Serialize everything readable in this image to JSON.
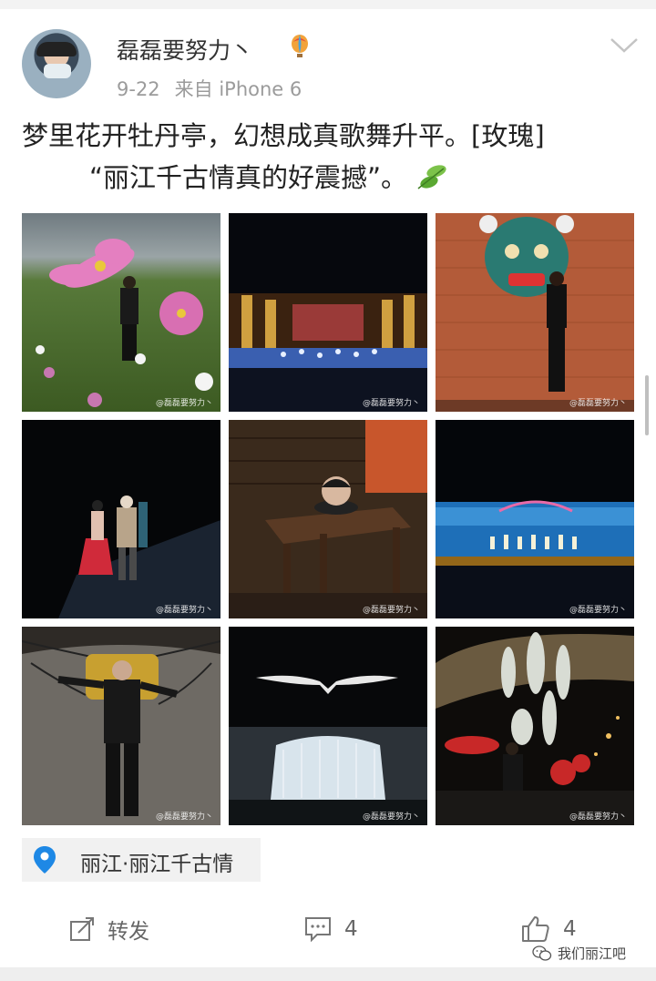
{
  "user": {
    "name": "磊磊要努力丶",
    "date": "9-22",
    "source": "来自 iPhone 6"
  },
  "post": {
    "line1": "梦里花开牡丹亭，幻想成真歌舞升平。[玫瑰]",
    "line2": "“丽江千古情真的好震撼”。"
  },
  "photos": {
    "watermark": "@磊磊要努力丶",
    "items": [
      "cosmos-flower-field",
      "stage-show-wide",
      "mask-wall-portrait",
      "red-dress-duet",
      "desk-with-head",
      "blue-stage-show",
      "chained-wall-pose",
      "waterfall-stage",
      "night-festival"
    ]
  },
  "location": {
    "label": "丽江·丽江千古情"
  },
  "actions": {
    "repost_label": "转发",
    "comment_count": "4",
    "like_count": "4"
  },
  "footer": {
    "brand": "我们丽江吧"
  },
  "colors": {
    "accent": "#1e88e5",
    "meta": "#9b9b9b"
  }
}
